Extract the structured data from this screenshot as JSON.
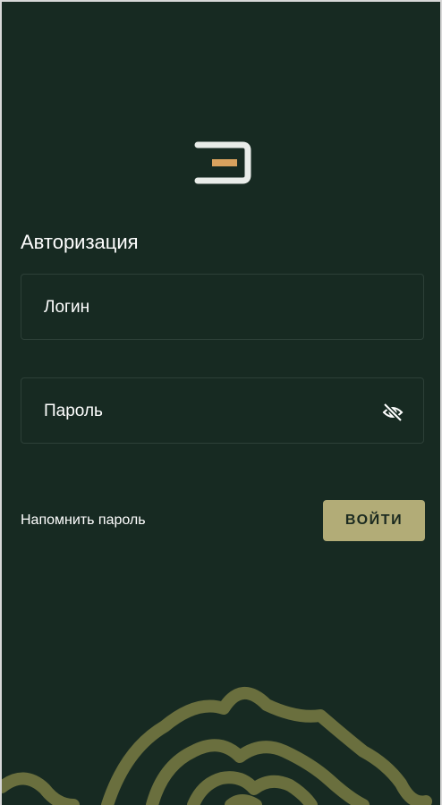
{
  "auth": {
    "title": "Авторизация",
    "login_placeholder": "Логин",
    "password_placeholder": "Пароль",
    "forgot_password": "Напомнить пароль",
    "submit_label": "ВОЙТИ"
  },
  "icons": {
    "logo": "app-logo",
    "password_toggle": "eye-off-icon"
  },
  "colors": {
    "background": "#172a22",
    "accent": "#b2ac77",
    "decoration": "#6a6f3e",
    "logo_bar": "#d9a25e"
  }
}
